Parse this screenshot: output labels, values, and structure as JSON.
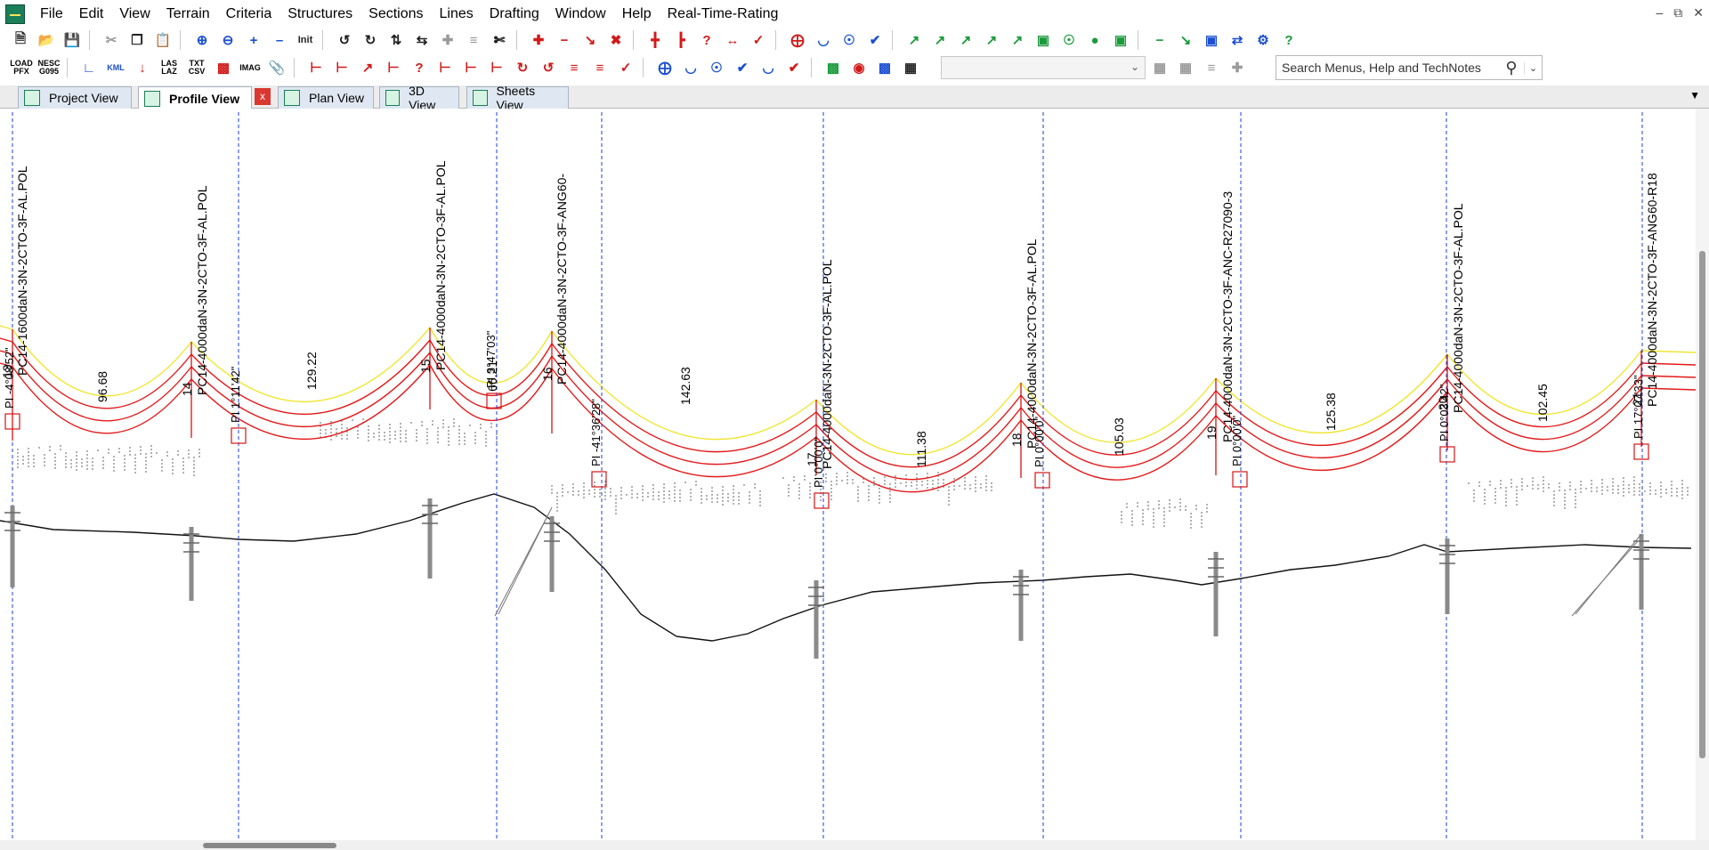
{
  "menu": {
    "items": [
      "File",
      "Edit",
      "View",
      "Terrain",
      "Criteria",
      "Structures",
      "Sections",
      "Lines",
      "Drafting",
      "Window",
      "Help",
      "Real-Time-Rating"
    ]
  },
  "toolbar2": {
    "load_pfx": "LOAD\nPFX",
    "nesc_g095": "NESC\nG095",
    "kml": "KML",
    "las_laz": "LAS\nLAZ",
    "txt_csv": "TXT\nCSV",
    "img": "IMAG"
  },
  "toolbar1": {
    "init_label": "Init"
  },
  "search": {
    "placeholder": "Search Menus, Help and TechNotes"
  },
  "tabs": [
    {
      "label": "Project View",
      "active": false
    },
    {
      "label": "Profile View",
      "active": true
    },
    {
      "label": "Plan View",
      "active": false
    },
    {
      "label": "3D View",
      "active": false
    },
    {
      "label": "Sheets View",
      "active": false
    }
  ],
  "tab_close": "x",
  "structures": [
    {
      "number": "13",
      "name": "PC14-1600daN-3N-2CTO-3F-AL.POL",
      "pi": "PI -4°08'52\""
    },
    {
      "number": "14",
      "name": "PC14-4000daN-3N-2CTO-3F-AL.POL",
      "pi": "PI 1°11'42\""
    },
    {
      "number": "15",
      "name": "PC14-4000daN-3N-2CTO-3F-AL.POL",
      "pi": "PI 3°47'03\""
    },
    {
      "number": "16",
      "name": "PC14-4000daN-3N-2CTO-3F-ANG60-",
      "pi": "PI -41°36'28\""
    },
    {
      "number": "17",
      "name": "PC14-4000daN-3N-2CTO-3F-AL.POL",
      "pi": "PI 0°00'0\""
    },
    {
      "number": "18",
      "name": "PC14-4000daN-3N-2CTO-3F-AL.POL",
      "pi": "PI 0°00'0\""
    },
    {
      "number": "19",
      "name": "PC14-4000daN-3N-2CTO-3F-ANC-R27090-3",
      "pi": "PI 0°00'0\""
    },
    {
      "number": "20",
      "name": "PC14-4000daN-3N-2CTO-3F-AL.POL",
      "pi": "PI 0°03'42\""
    },
    {
      "number": "21",
      "name": "PC14-4000daN-3N-2CTO-3F-ANG60-R18",
      "pi": "PI 17°07'33\""
    }
  ],
  "spans": [
    "96.68",
    "129.22",
    "66.21",
    "142.63",
    "111.38",
    "105.03",
    "125.38",
    "102.45"
  ],
  "colors": {
    "conductor": "#e41a1a",
    "shield_wire": "#f0e632",
    "ground": "#111111",
    "station_line": "#1f3fd6",
    "structure": "#d61414",
    "pole": "#8a8a8a"
  }
}
